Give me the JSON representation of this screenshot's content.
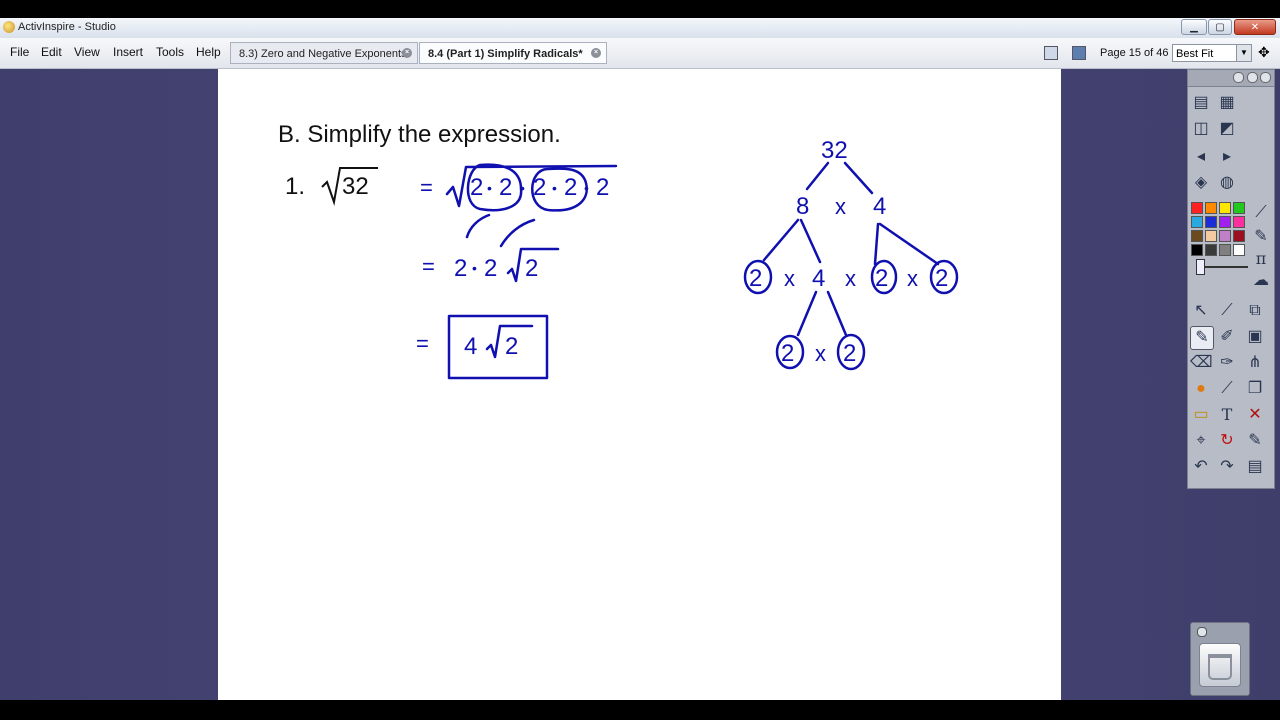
{
  "window": {
    "title": "ActivInspire - Studio"
  },
  "menu": {
    "items": [
      "File",
      "Edit",
      "View",
      "Insert",
      "Tools",
      "Help"
    ]
  },
  "tabs": [
    {
      "label": "8.3) Zero and Negative Exponents",
      "active": false
    },
    {
      "label": "8.4 (Part 1) Simplify Radicals*",
      "active": true
    }
  ],
  "navigation": {
    "page_counter": "Page 15 of 46",
    "zoom": "Best Fit"
  },
  "flipchart": {
    "heading": "B. Simplify the expression.",
    "problem_number": "1.",
    "radicand": "32",
    "step1": {
      "equals": "=",
      "factors": [
        "2",
        "2",
        "2",
        "2",
        "2"
      ],
      "dot": "•"
    },
    "step2": {
      "equals": "=",
      "outside": [
        "2",
        "2"
      ],
      "radicand": "2"
    },
    "answer": {
      "equals": "=",
      "coefficient": "4",
      "radicand": "2"
    },
    "factor_tree": {
      "root": "32",
      "level1": [
        "8",
        "x",
        "4"
      ],
      "level2": [
        "2",
        "x",
        "4",
        "x",
        "2",
        "x",
        "2"
      ],
      "level3": [
        "2",
        "x",
        "2"
      ]
    }
  },
  "toolbox": {
    "palette": [
      "#ff2020",
      "#ff8a00",
      "#ffe600",
      "#22c81e",
      "#2aa9e0",
      "#1c2cd6",
      "#a020f0",
      "#ff2fa0",
      "#6b4a1e",
      "#f2c9a0",
      "#c080c8",
      "#9a1020",
      "#000000",
      "#3a3a3a",
      "#808080",
      "#ffffff"
    ]
  },
  "colors": {
    "ink": "#1010b0",
    "workspace": "#454372",
    "page": "#ffffff"
  }
}
